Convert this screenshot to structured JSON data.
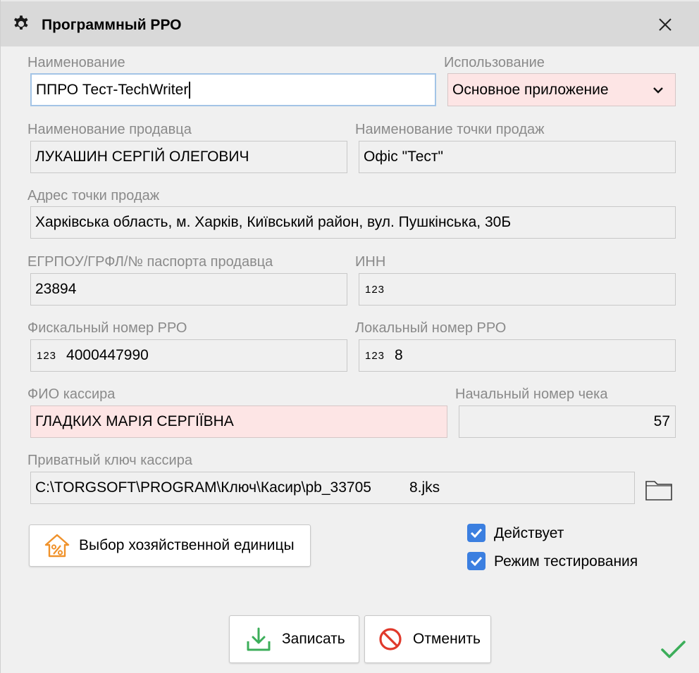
{
  "window": {
    "title": "Программный РРО"
  },
  "form": {
    "name": {
      "label": "Наименование",
      "value": "ППРО Тест-TechWriter"
    },
    "usage": {
      "label": "Использование",
      "value": "Основное приложение"
    },
    "seller_name": {
      "label": "Наименование продавца",
      "value": "ЛУКАШИН СЕРГІЙ ОЛЕГОВИЧ"
    },
    "point_name": {
      "label": "Наименование точки продаж",
      "value": "Офіс \"Тест\""
    },
    "point_address": {
      "label": "Адрес точки продаж",
      "value": "Харківська область, м. Харків, Київський район, вул. Пушкінська, 30Б"
    },
    "seller_id": {
      "label": "ЕГРПОУ/ГРФЛ/№ паспорта продавца",
      "value": "23894"
    },
    "inn": {
      "label": "ИНН",
      "value": ""
    },
    "fiscal_number": {
      "label": "Фискальный номер РРО",
      "value": "4000447990"
    },
    "local_number": {
      "label": "Локальный номер РРО",
      "value": "8"
    },
    "cashier_name": {
      "label": "ФИО кассира",
      "value": "ГЛАДКИХ МАРІЯ СЕРГІЇВНА"
    },
    "receipt_start": {
      "label": "Начальный номер чека",
      "value": "57"
    },
    "private_key": {
      "label": "Приватный ключ кассира",
      "value_start": "C:\\TORGSOFT\\PROGRAM\\Ключ\\Касир\\pb_33705",
      "value_end": "8.jks"
    },
    "numeric_icon": "123"
  },
  "buttons": {
    "choose_unit": "Выбор хозяйственной единицы",
    "save": "Записать",
    "cancel": "Отменить"
  },
  "checkboxes": {
    "active": {
      "label": "Действует",
      "checked": true
    },
    "test_mode": {
      "label": "Режим тестирования",
      "checked": true
    }
  },
  "colors": {
    "accent": "#3b7fe0",
    "invalid_bg": "#fde5e5",
    "save_green": "#3cae5a",
    "cancel_red": "#e0392b",
    "unit_orange": "#f0922b"
  },
  "icons": [
    "gear-icon",
    "close-icon",
    "chevron-down-icon",
    "numeric-icon",
    "folder-icon",
    "house-percent-icon",
    "download-icon",
    "forbidden-icon",
    "checkmark-icon"
  ]
}
